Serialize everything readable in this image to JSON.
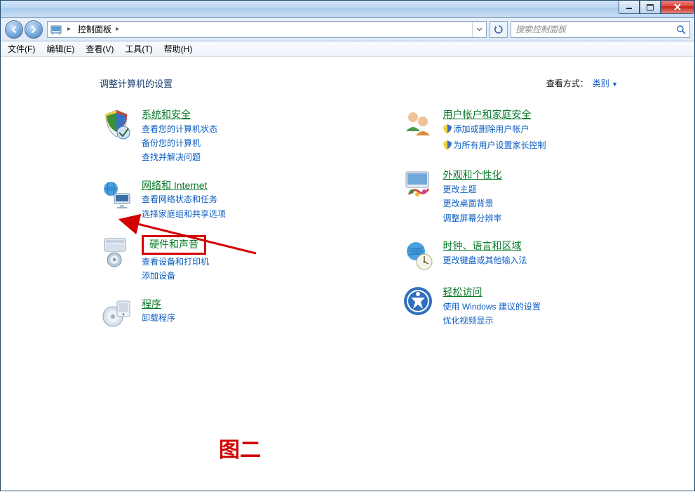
{
  "titlebar": {
    "min_label": "minimize",
    "max_label": "maximize",
    "close_label": "close"
  },
  "address": {
    "path_root_icon": "control-panel",
    "path_text": "控制面板",
    "path_sep": "▸",
    "refresh_label": "refresh"
  },
  "search": {
    "placeholder": "搜索控制面板"
  },
  "menu": {
    "items": [
      "文件(F)",
      "编辑(E)",
      "查看(V)",
      "工具(T)",
      "帮助(H)"
    ]
  },
  "heading": "调整计算机的设置",
  "viewby": {
    "label": "查看方式：",
    "value": "类别"
  },
  "left_categories": [
    {
      "id": "system-security",
      "title": "系统和安全",
      "links": [
        "查看您的计算机状态",
        "备份您的计算机",
        "查找并解决问题"
      ]
    },
    {
      "id": "network-internet",
      "title": "网络和 Internet",
      "links": [
        "查看网络状态和任务",
        "选择家庭组和共享选项"
      ]
    },
    {
      "id": "hardware-sound",
      "title": "硬件和声音",
      "highlighted": true,
      "links": [
        "查看设备和打印机",
        "添加设备"
      ]
    },
    {
      "id": "programs",
      "title": "程序",
      "links": [
        "卸载程序"
      ]
    }
  ],
  "right_categories": [
    {
      "id": "user-accounts",
      "title": "用户帐户和家庭安全",
      "links": [
        {
          "text": "添加或删除用户帐户",
          "shield": true
        },
        {
          "text": "为所有用户设置家长控制",
          "shield": true
        }
      ]
    },
    {
      "id": "appearance",
      "title": "外观和个性化",
      "links": [
        "更改主题",
        "更改桌面背景",
        "调整屏幕分辨率"
      ]
    },
    {
      "id": "clock-region",
      "title": "时钟、语言和区域",
      "links": [
        "更改键盘或其他输入法"
      ]
    },
    {
      "id": "ease-of-access",
      "title": "轻松访问",
      "links": [
        "使用 Windows 建议的设置",
        "优化视频显示"
      ]
    }
  ],
  "annotation": {
    "label": "图二"
  }
}
